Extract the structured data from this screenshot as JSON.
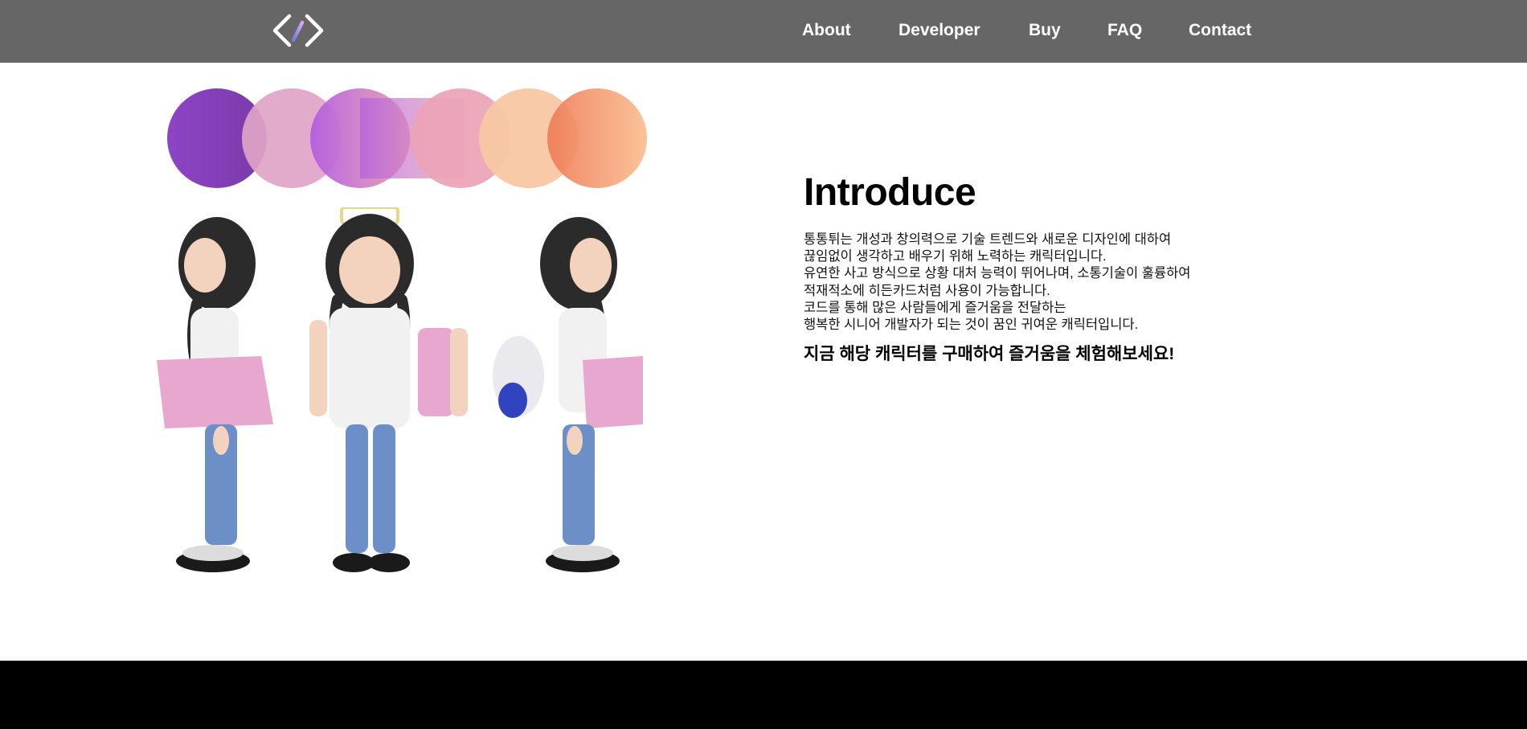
{
  "header": {
    "logo_icon": "code-brackets-icon",
    "nav": [
      {
        "label": "About"
      },
      {
        "label": "Developer"
      },
      {
        "label": "Buy"
      },
      {
        "label": "FAQ"
      },
      {
        "label": "Contact"
      }
    ]
  },
  "intro": {
    "title": "Introduce",
    "description_lines": [
      "통통튀는 개성과 창의력으로 기술 트렌드와 새로운 디자인에 대하여",
      "끊임없이 생각하고 배우기 위해 노력하는 캐릭터입니다.",
      "유연한 사고 방식으로 상황 대처 능력이 뛰어나며, 소통기술이 훌륭하여",
      "적재적소에 히든카드처럼 사용이 가능합니다.",
      "코드를 통해 많은 사람들에게 즐거움을 전달하는",
      "행복한 시니어 개발자가 되는 것이 꿈인 귀여운 캐릭터입니다."
    ],
    "cta": "지금 해당 캐릭터를 구매하여 즐거움을 체험해보세요!"
  },
  "colors": {
    "navbar": "#666666",
    "footer": "#000000",
    "background": "#ffffff",
    "circle_purple": "#8e44c6",
    "circle_pink": "#dca0c4",
    "circle_orange": "#f3845e",
    "circle_peach": "#f9c39d"
  }
}
